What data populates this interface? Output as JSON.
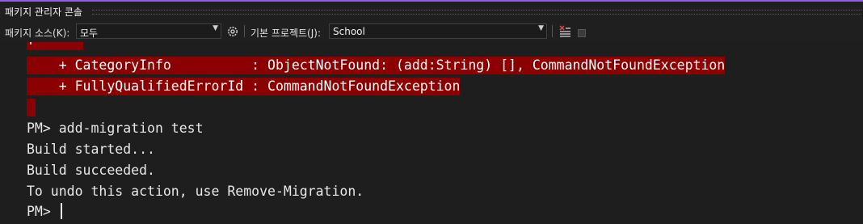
{
  "window": {
    "title": "패키지 관리자 콘솔"
  },
  "toolbar": {
    "source_label": "패키지 소스(K):",
    "source_value": "모두",
    "project_label": "기본 프로젝트(J):",
    "project_value": "School"
  },
  "console": {
    "error_lines": [
      "+ ~~~~~",
      "    + CategoryInfo          : ObjectNotFound: (add:String) [], CommandNotFoundException",
      "    + FullyQualifiedErrorId : CommandNotFoundException",
      " "
    ],
    "output_lines": [
      "PM> add-migration test",
      "Build started...",
      "Build succeeded.",
      "To undo this action, use Remove-Migration."
    ],
    "prompt": "PM> "
  }
}
